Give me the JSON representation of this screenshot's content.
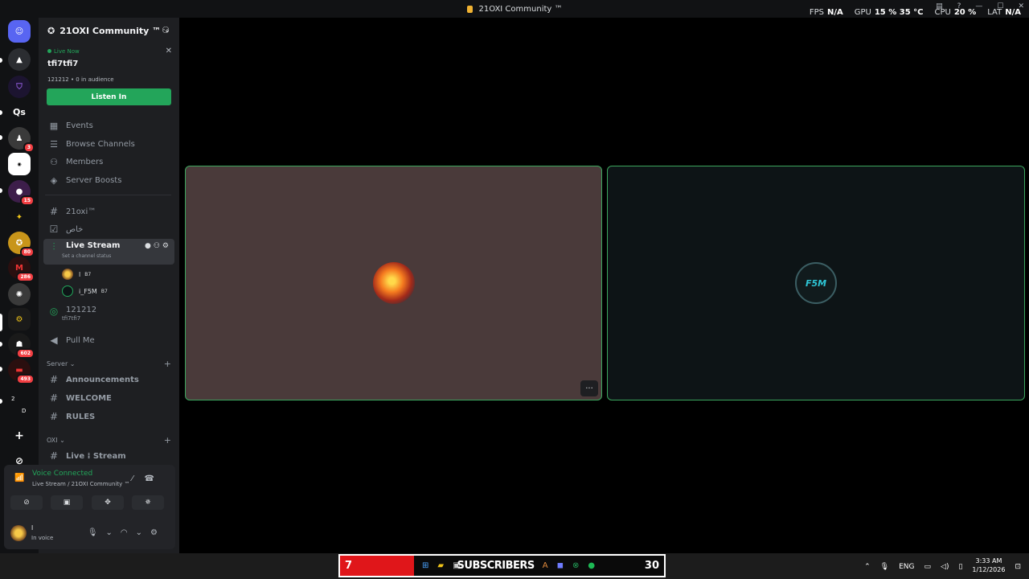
{
  "window": {
    "title": "21OXI Community ™"
  },
  "overlay": {
    "fps_label": "FPS",
    "fps_value": "N/A",
    "gpu_label": "GPU",
    "gpu_value": "15 %  35 °C",
    "cpu_label": "CPU",
    "cpu_value": "20 %",
    "lat_label": "LAT",
    "lat_value": "N/A"
  },
  "guilds": {
    "qs_label": "Qs",
    "badges": [
      "3",
      "15",
      "80",
      "286",
      "602",
      "493"
    ],
    "misc": [
      "2",
      "D"
    ]
  },
  "server": {
    "name": "21OXI Community ™"
  },
  "live_now": {
    "badge": "Live Now",
    "title": "tfi7tfi7",
    "meta": "121212  •  0 in audience",
    "button": "Listen In"
  },
  "nav": [
    {
      "label": "Events",
      "icon": "calendar-icon"
    },
    {
      "label": "Browse Channels",
      "icon": "list-icon"
    },
    {
      "label": "Members",
      "icon": "members-icon"
    },
    {
      "label": "Server Boosts",
      "icon": "boost-icon"
    }
  ],
  "channels": {
    "c1": "21oxi™",
    "c2": "خاص",
    "live": {
      "name": "Live Stream",
      "status": "Set a channel status"
    },
    "voice_users": [
      {
        "name": "l",
        "tag": "B7"
      },
      {
        "name": "i_F5M",
        "tag": "B7"
      }
    ],
    "stage": {
      "name": "121212",
      "sub": "tfi7tfi7"
    },
    "pull": "Pull Me"
  },
  "cat_server": {
    "name": "Server",
    "channels": [
      "Announcements",
      "WELCOME",
      "RULES"
    ]
  },
  "cat_oxi": {
    "name": "OXI",
    "channels": [
      "Live ⁞ Stream"
    ]
  },
  "voice_panel": {
    "status": "Voice Connected",
    "sub": "Live Stream / 21OXI Community ™"
  },
  "user": {
    "name": "l",
    "sub": "In voice"
  },
  "tiles": [
    {
      "name": "l"
    },
    {
      "name": "i_F5M",
      "avatar_text": "F5M"
    }
  ],
  "taskbar": {
    "sub_num": "7",
    "sub_label": "SUBSCRIBERS",
    "sub_count": "30",
    "lang": "ENG",
    "time": "3:33 AM",
    "date": "1/12/2026"
  },
  "colors": {
    "accent_green": "#23a55a",
    "tile_border": "#3ba55d",
    "red": "#e0161a"
  }
}
